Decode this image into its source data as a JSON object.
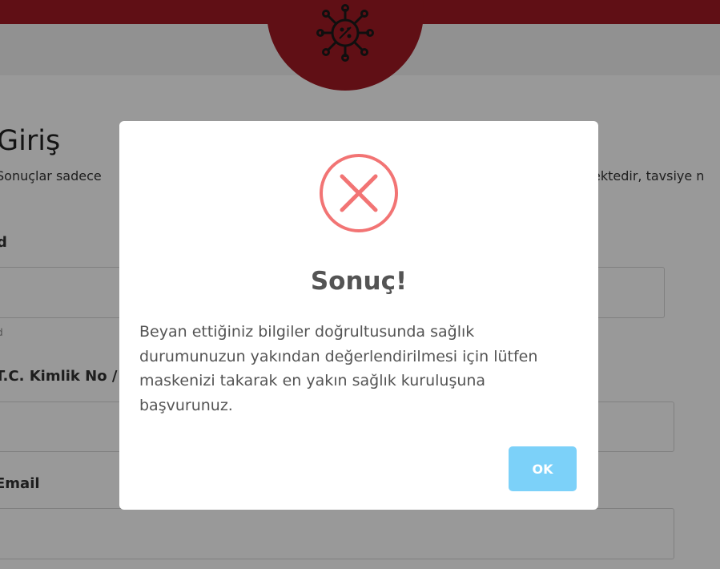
{
  "background": {
    "heading": "Giriş",
    "subtitle_left": "Sonuçlar sadece",
    "subtitle_right": "ektedir, tavsiye n",
    "field_name": {
      "label": "d",
      "hint": "d"
    },
    "field_id": {
      "label": "T.C. Kimlik No / Y"
    },
    "field_email": {
      "label": "Email"
    }
  },
  "dialog": {
    "icon": "error-x-icon",
    "title": "Sonuç!",
    "message": "Beyan ettiğiniz bilgiler doğrultusunda sağlık durumunuzun yakından değerlendirilmesi için lütfen maskenizi takarak en yakın sağlık kuruluşuna başvurunuz.",
    "ok_label": "OK"
  },
  "colors": {
    "brand_red": "#a11a23",
    "error_icon": "#f27474",
    "ok_button": "#7cd1f9",
    "text": "#545454"
  }
}
